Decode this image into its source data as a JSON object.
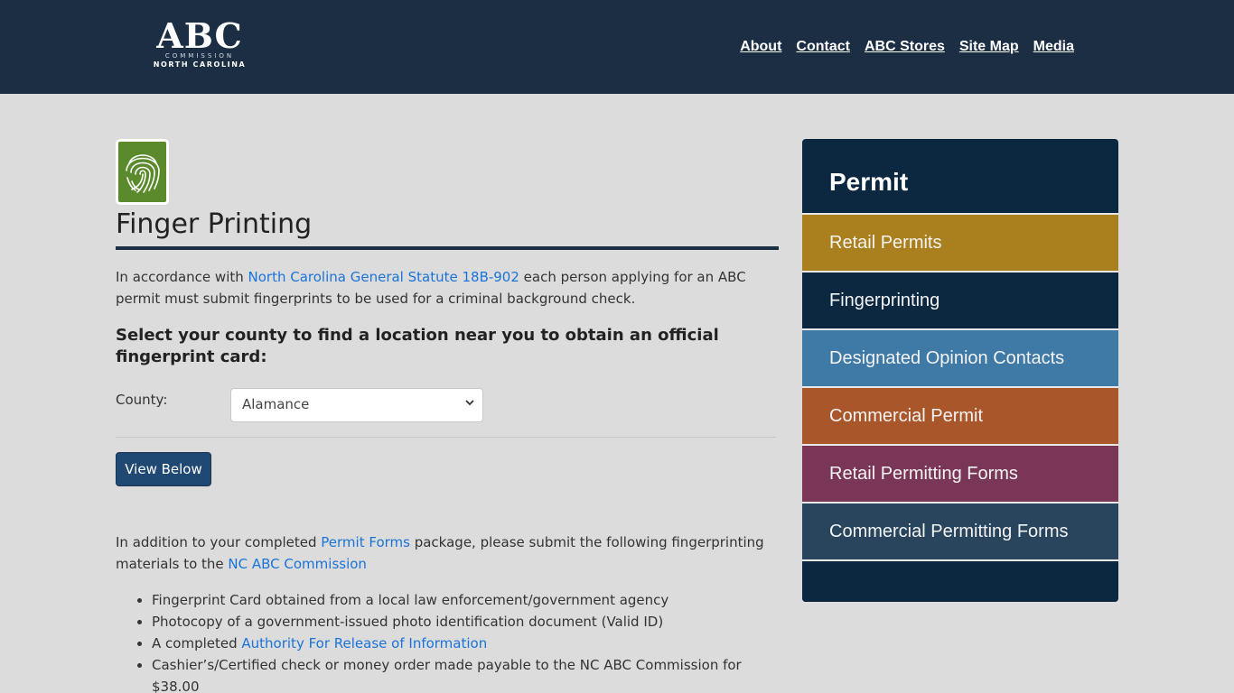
{
  "header": {
    "logo": {
      "abc": "ABC",
      "commission": "COMMISSION",
      "state": "NORTH CAROLINA"
    },
    "nav": [
      "About",
      "Contact",
      "ABC Stores",
      "Site Map",
      "Media"
    ]
  },
  "main": {
    "icon": "fingerprint-icon",
    "title": "Finger Printing",
    "intro": {
      "before": "In accordance with ",
      "link": "North Carolina General Statute 18B-902",
      "after": " each person applying for an ABC permit must submit fingerprints to be used for a criminal background check."
    },
    "select_heading": "Select your county to find a location near you to obtain an official fingerprint card:",
    "county_label": "County:",
    "county_value": "Alamance",
    "view_button": "View Below",
    "addition": {
      "part1": "In addition to your completed ",
      "link1": "Permit Forms",
      "part2": " package, please submit the following fingerprinting materials to the ",
      "link2": "NC ABC Commission"
    },
    "requirements": {
      "item1": "Fingerprint Card obtained from a local law enforcement/government agency",
      "item2": "Photocopy of a government-issued photo identification document (Valid ID)",
      "item3_before": "A completed ",
      "item3_link": "Authority For Release of Information",
      "item4": "Cashier’s/Certified check or money order made payable to the NC ABC Commission for $38.00"
    }
  },
  "sidebar": {
    "title": "Permit",
    "items": [
      {
        "label": "Retail Permits",
        "color": "#aa801e"
      },
      {
        "label": "Fingerprinting",
        "color": "#0c2840"
      },
      {
        "label": "Designated Opinion Contacts",
        "color": "#3f79a6"
      },
      {
        "label": "Commercial Permit",
        "color": "#a9572a"
      },
      {
        "label": "Retail Permitting Forms",
        "color": "#7a3657"
      },
      {
        "label": "Commercial Permitting Forms",
        "color": "#28455d"
      }
    ]
  },
  "colors": {
    "header_bg": "#1b2e44",
    "page_bg": "#dcdcdc",
    "link": "#1a73d9",
    "button": "#1f4872",
    "sidebar_bg": "#0c2840"
  }
}
